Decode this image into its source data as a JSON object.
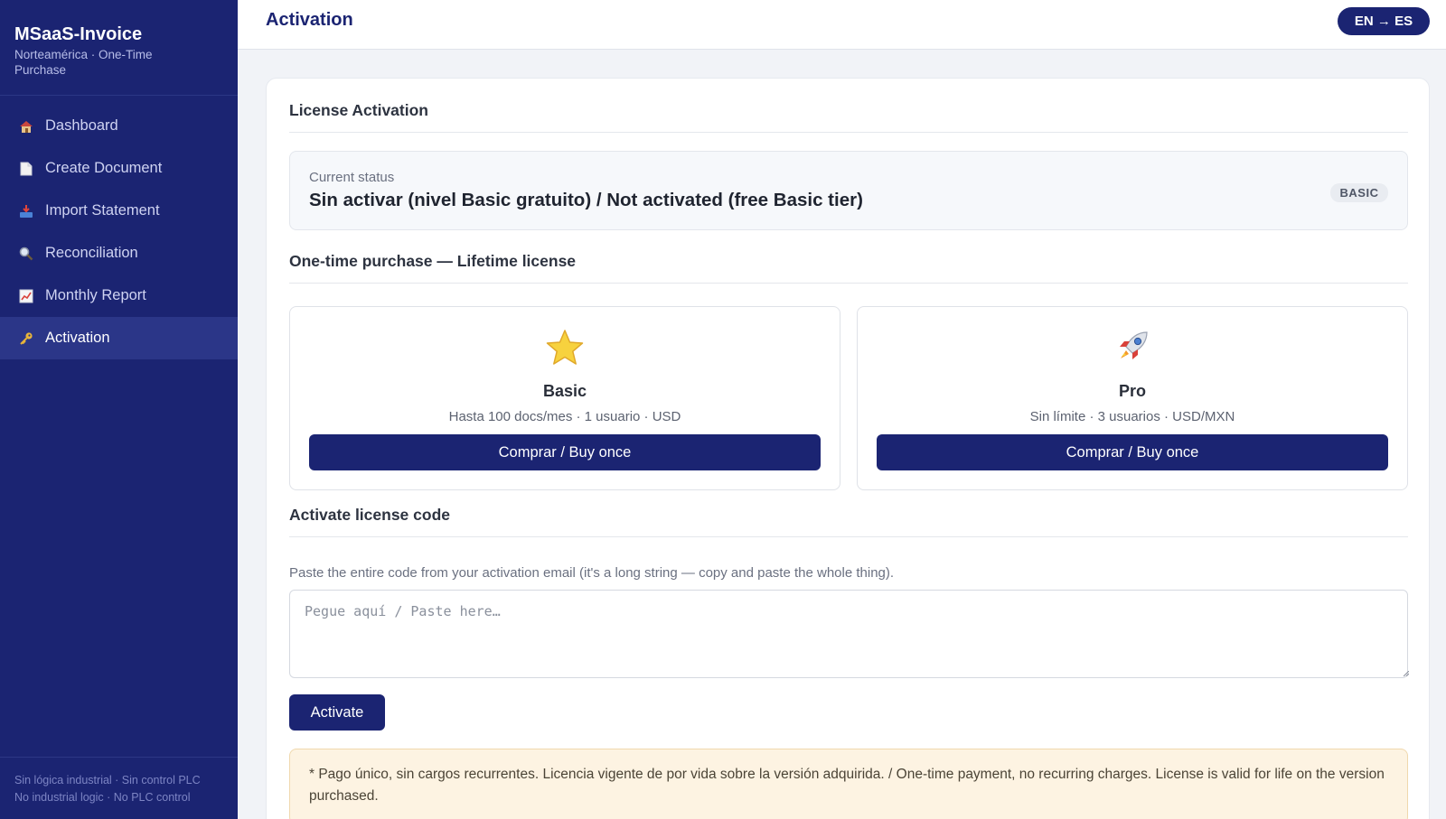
{
  "sidebar": {
    "brand_title": "MSaaS-Invoice",
    "brand_subtitle": "Norteamérica · One-Time Purchase",
    "items": [
      {
        "label": "Dashboard",
        "icon": "house-icon"
      },
      {
        "label": "Create Document",
        "icon": "document-icon"
      },
      {
        "label": "Import Statement",
        "icon": "inbox-tray-icon"
      },
      {
        "label": "Reconciliation",
        "icon": "magnifier-icon"
      },
      {
        "label": "Monthly Report",
        "icon": "chart-icon"
      },
      {
        "label": "Activation",
        "icon": "key-icon",
        "active": true
      }
    ],
    "footer_line1": "Sin lógica industrial · Sin control PLC",
    "footer_line2": "No industrial logic · No PLC control"
  },
  "header": {
    "title": "Activation",
    "lang_toggle": "EN → ES"
  },
  "license": {
    "section_title": "License Activation",
    "status_label": "Current status",
    "status_value": "Sin activar (nivel Basic gratuito) / Not activated (free Basic tier)",
    "badge": "BASIC"
  },
  "purchase": {
    "section_title": "One-time purchase — Lifetime license",
    "plans": [
      {
        "name": "Basic",
        "icon": "star-icon",
        "description": "Hasta 100 docs/mes · 1 usuario · USD",
        "button": "Comprar / Buy once"
      },
      {
        "name": "Pro",
        "icon": "rocket-icon",
        "description": "Sin límite · 3 usuarios · USD/MXN",
        "button": "Comprar / Buy once"
      }
    ]
  },
  "activate": {
    "section_title": "Activate license code",
    "hint": "Paste the entire code from your activation email (it's a long string — copy and paste the whole thing).",
    "placeholder": "Pegue aquí / Paste here…",
    "value": "",
    "button": "Activate"
  },
  "note": "* Pago único, sin cargos recurrentes. Licencia vigente de por vida sobre la versión adquirida. / One-time payment, no recurring charges. License is valid for life on the version purchased.",
  "colors": {
    "primary": "#1b2472",
    "sidebar_active": "#2b3688",
    "note_bg": "#fdf3e2",
    "page_bg": "#f1f3f7"
  }
}
